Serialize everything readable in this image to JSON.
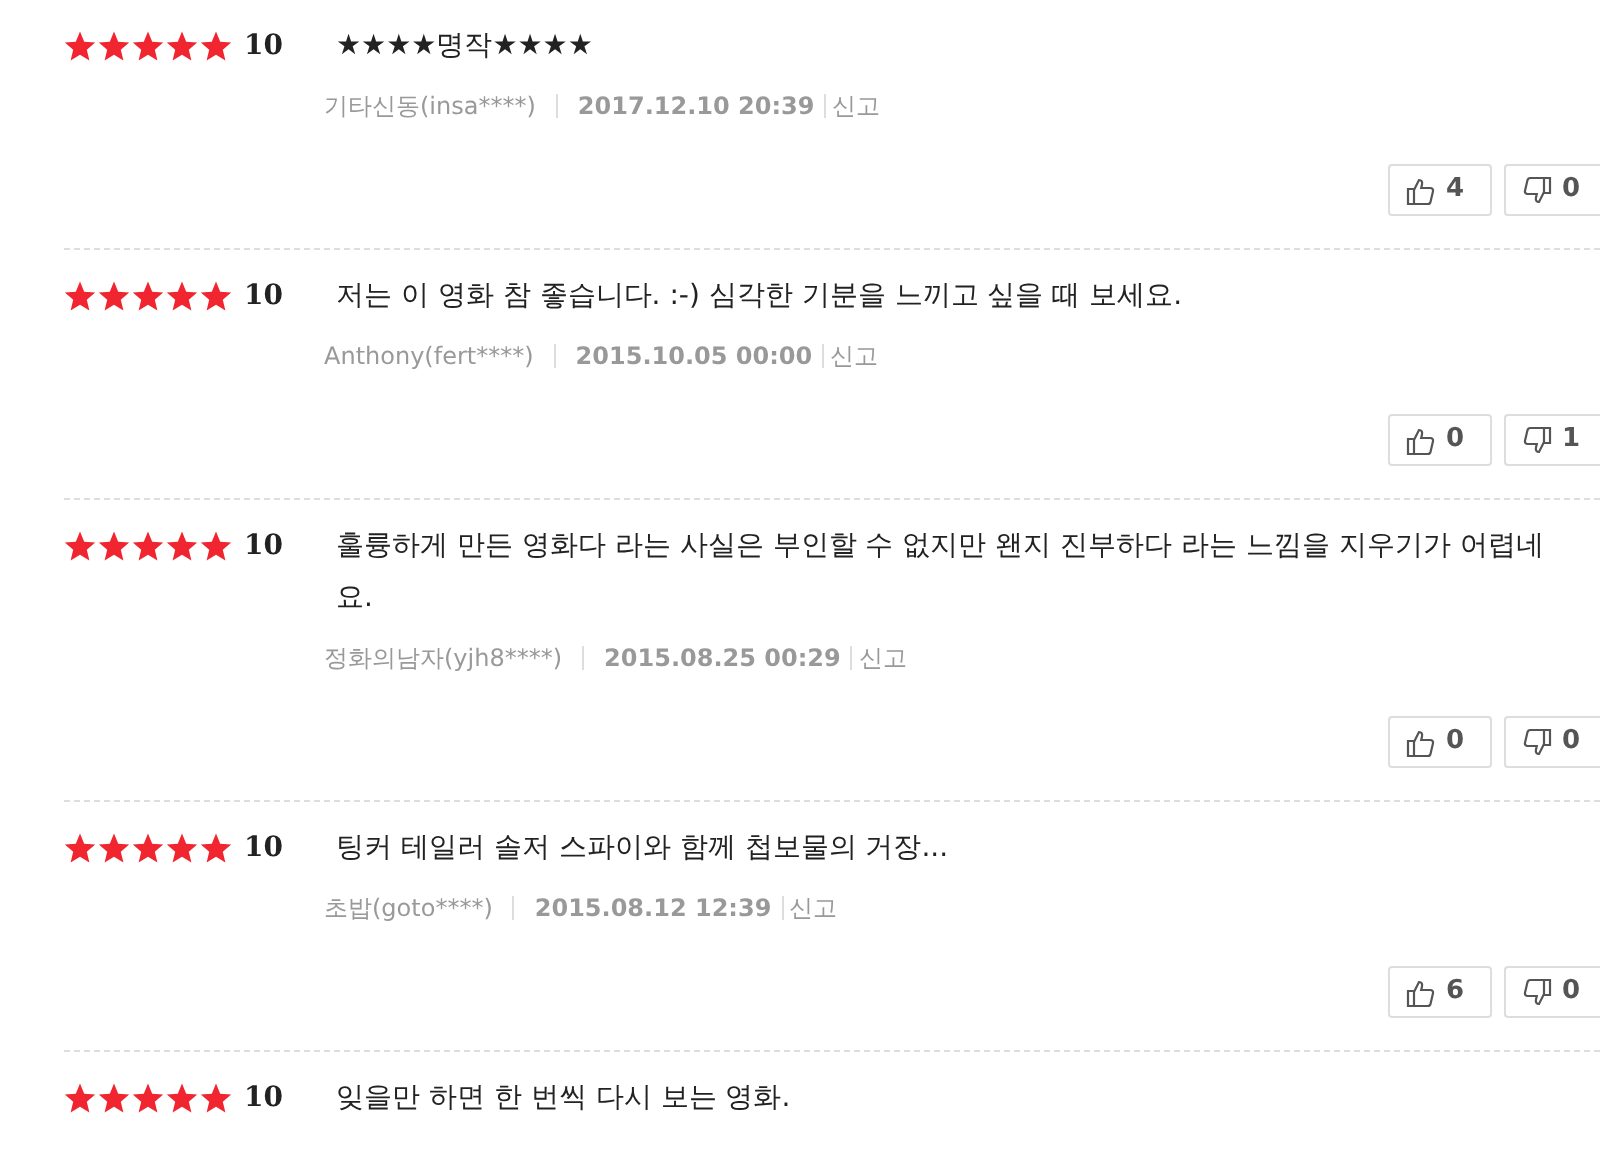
{
  "reviews": [
    {
      "stars": 5,
      "score": "10",
      "text": "★★★★명작★★★★",
      "author": "기타신동(insa****)",
      "date": "2017.12.10 20:39",
      "report": "신고",
      "likes": "4",
      "dislikes": "0"
    },
    {
      "stars": 5,
      "score": "10",
      "text": "저는 이 영화 참 좋습니다. :-) 심각한 기분을 느끼고 싶을 때 보세요.",
      "author": "Anthony(fert****)",
      "date": "2015.10.05 00:00",
      "report": "신고",
      "likes": "0",
      "dislikes": "1"
    },
    {
      "stars": 5,
      "score": "10",
      "text": "훌륭하게 만든 영화다 라는 사실은 부인할 수 없지만 왠지 진부하다 라는 느낌을 지우기가 어렵네요.",
      "author": "정화의남자(yjh8****)",
      "date": "2015.08.25 00:29",
      "report": "신고",
      "likes": "0",
      "dislikes": "0"
    },
    {
      "stars": 5,
      "score": "10",
      "text": "팅커 테일러 솔저 스파이와 함께 첩보물의 거장...",
      "author": "초밥(goto****)",
      "date": "2015.08.12 12:39",
      "report": "신고",
      "likes": "6",
      "dislikes": "0"
    },
    {
      "stars": 5,
      "score": "10",
      "text": "잊을만 하면 한 번씩 다시 보는 영화."
    }
  ]
}
